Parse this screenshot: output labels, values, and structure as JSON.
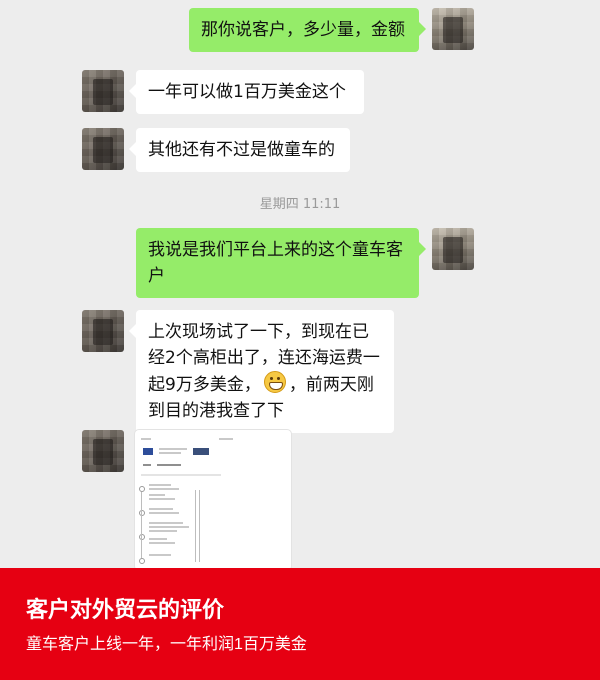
{
  "chat": {
    "messages": [
      {
        "side": "right",
        "text": "那你说客户，多少量，金额"
      },
      {
        "side": "left",
        "text": "一年可以做1百万美金这个"
      },
      {
        "side": "left",
        "text": "其他还有不过是做童车的"
      },
      {
        "side": "right",
        "text": "我说是我们平台上来的这个童车客户"
      },
      {
        "side": "left",
        "text_before_emoji": "上次现场试了一下，到现在已经2个高柜出了，连还海运费一起9万多美金，",
        "emoji": "grin-emoji",
        "text_after_emoji": "，前两天刚到目的港我查了下"
      }
    ],
    "timestamp": "星期四 11:11",
    "attachment": {
      "type": "shipping-document-image"
    }
  },
  "colors": {
    "sent_bubble": "#95ec69",
    "received_bubble": "#ffffff",
    "chat_background": "#ededed",
    "banner_background": "#e60012"
  },
  "banner": {
    "title": "客户对外贸云的评价",
    "subtitle": "童车客户上线一年，一年利润1百万美金"
  }
}
